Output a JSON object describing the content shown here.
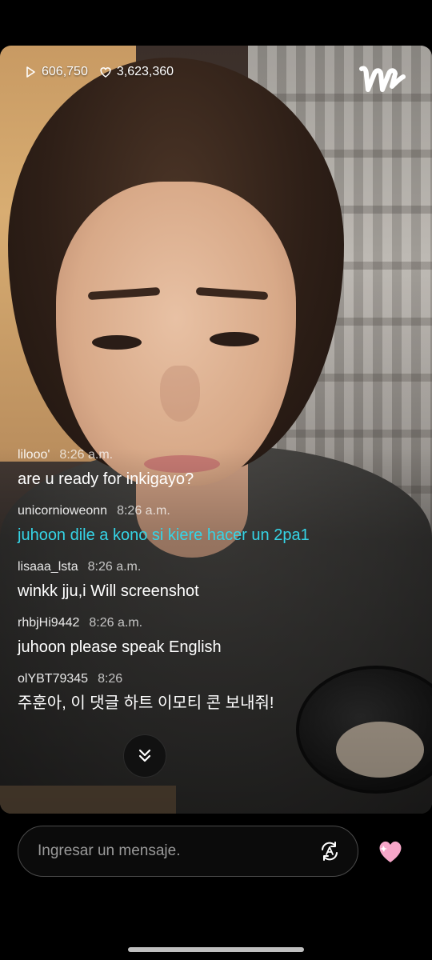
{
  "stats": {
    "plays": "606,750",
    "likes": "3,623,360"
  },
  "comments": [
    {
      "user": "lilooo'",
      "time": "8:26 a.m.",
      "text": "are u ready for inkigayo?",
      "highlight": false
    },
    {
      "user": "unicornioweonn",
      "time": "8:26 a.m.",
      "text": "juhoon dile a kono si kiere hacer un 2pa1",
      "highlight": true
    },
    {
      "user": "lisaaa_lsta",
      "time": "8:26 a.m.",
      "text": "winkk jju,i Will screenshot",
      "highlight": false
    },
    {
      "user": "rhbjHi9442",
      "time": "8:26 a.m.",
      "text": "juhoon please speak English",
      "highlight": false
    },
    {
      "user": "olYBT79345",
      "time": "8:26",
      "text": "주훈아, 이 댓글 하트 이모티 콘 보내줘!",
      "highlight": false
    }
  ],
  "input": {
    "placeholder": "Ingresar un mensaje."
  },
  "icons": {
    "play": "play-icon",
    "heart": "heart-icon",
    "logo": "weverse-logo",
    "scroll": "chevron-double-down-icon",
    "translate": "translate-icon",
    "send_heart": "pink-heart-icon"
  },
  "colors": {
    "highlight_comment": "#35d4e6",
    "heart": "#f6a6c8",
    "background": "#000000"
  }
}
